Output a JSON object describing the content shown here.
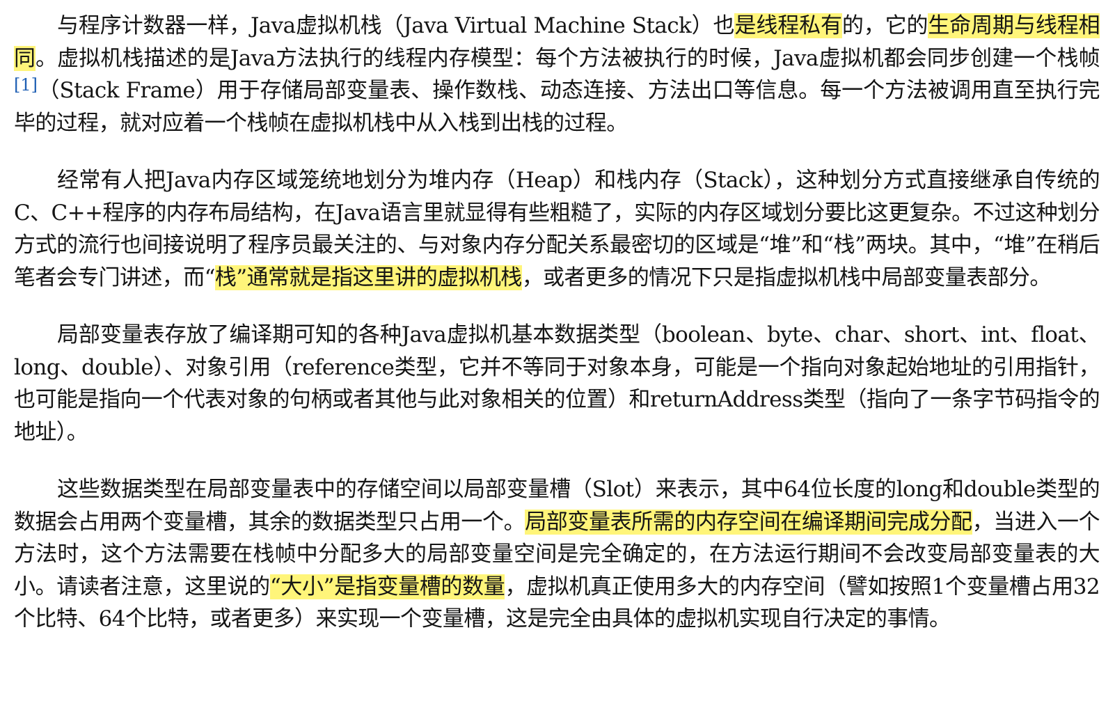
{
  "paragraphs": [
    {
      "segments": [
        {
          "text": "与程序计数器一样，Java虚拟机栈（Java Virtual Machine Stack）也",
          "highlight": false
        },
        {
          "text": "是线程私有",
          "highlight": true
        },
        {
          "text": "的，它的",
          "highlight": false
        },
        {
          "text": "生命周期与线程相同",
          "highlight": true
        },
        {
          "text": "。虚拟机栈描述的是Java方法执行的线程内存模型：每个方法被执行的时候，Java虚拟机都会同步创建一个栈帧",
          "highlight": false
        },
        {
          "text": "[1]",
          "footnote": true
        },
        {
          "text": "（Stack Frame）用于存储局部变量表、操作数栈、动态连接、方法出口等信息。每一个方法被调用直至执行完毕的过程，就对应着一个栈帧在虚拟机栈中从入栈到出栈的过程。",
          "highlight": false
        }
      ]
    },
    {
      "segments": [
        {
          "text": "经常有人把Java内存区域笼统地划分为堆内存（Heap）和栈内存（Stack），这种划分方式直接继承自传统的C、C++程序的内存布局结构，在Java语言里就显得有些粗糙了，实际的内存区域划分要比这更复杂。不过这种划分方式的流行也间接说明了程序员最关注的、与对象内存分配关系最密切的区域是“堆”和“栈”两块。其中，“堆”在稍后笔者会专门讲述，而“",
          "highlight": false
        },
        {
          "text": "栈”通常就是指这里讲的虚拟机栈",
          "highlight": true
        },
        {
          "text": "，或者更多的情况下只是指虚拟机栈中局部变量表部分。",
          "highlight": false
        }
      ]
    },
    {
      "segments": [
        {
          "text": "局部变量表存放了编译期可知的各种Java虚拟机基本数据类型（boolean、byte、char、short、int、float、long、double）、对象引用（reference类型，它并不等同于对象本身，可能是一个指向对象起始地址的引用指针，也可能是指向一个代表对象的句柄或者其他与此对象相关的位置）和returnAddress类型（指向了一条字节码指令的地址）。",
          "highlight": false
        }
      ]
    },
    {
      "segments": [
        {
          "text": "这些数据类型在局部变量表中的存储空间以局部变量槽（Slot）来表示，其中64位长度的long和double类型的数据会占用两个变量槽，其余的数据类型只占用一个。",
          "highlight": false
        },
        {
          "text": "局部变量表所需的内存空间在编译期间完成分配",
          "highlight": true
        },
        {
          "text": "，当进入一个方法时，这个方法需要在栈帧中分配多大的局部变量空间是完全确定的，在方法运行期间不会改变局部变量表的大小。请读者注意，这里说的",
          "highlight": false
        },
        {
          "text": "“大小”是指变量槽的数量",
          "highlight": true
        },
        {
          "text": "，虚拟机真正使用多大的内存空间（譬如按照1个变量槽占用32个比特、64个比特，或者更多）来实现一个变量槽，这是完全由具体的虚拟机实现自行决定的事情。",
          "highlight": false
        }
      ]
    }
  ]
}
